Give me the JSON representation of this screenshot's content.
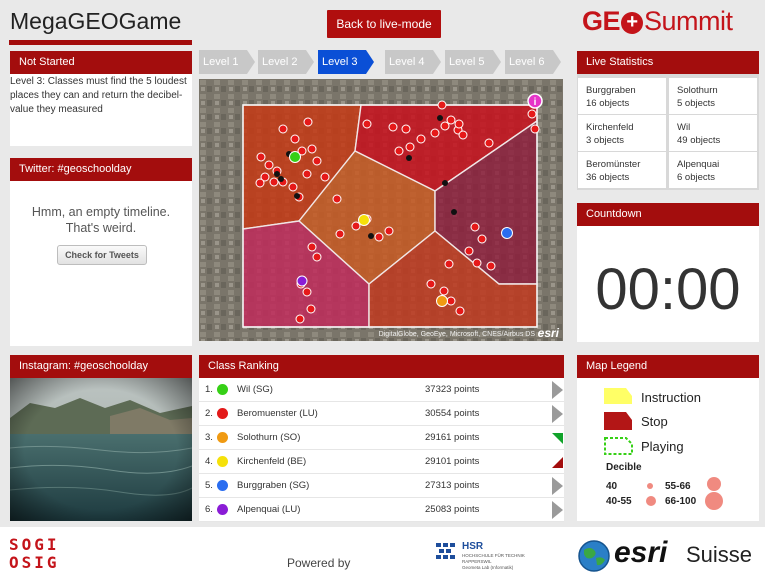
{
  "header": {
    "title": "MegaGEOGame",
    "back_button": "Back to live-mode",
    "logo_left": "GE",
    "logo_right": "Summit"
  },
  "levels": [
    "Level 1",
    "Level 2",
    "Level 3",
    "Level 4",
    "Level 5",
    "Level 6"
  ],
  "active_level": "Level 3",
  "status": {
    "heading": "Not Started",
    "description": "Level 3: Classes must find the 5 loudest places they can and return the decibel-value they measured"
  },
  "twitter": {
    "heading": "Twitter: #geoschoolday",
    "empty_line1": "Hmm, an empty timeline.",
    "empty_line2": "That's weird.",
    "button": "Check for Tweets"
  },
  "instagram": {
    "heading": "Instagram: #geoschoolday"
  },
  "map": {
    "attribution": "DigitalGlobe, GeoEye, Microsoft, CNES/Airbus DS",
    "brand": "esri"
  },
  "live_statistics": {
    "heading": "Live Statistics",
    "cells": [
      {
        "name": "Burggraben",
        "count": "16 objects"
      },
      {
        "name": "Solothurn",
        "count": "5 objects"
      },
      {
        "name": "Kirchenfeld",
        "count": "3 objects"
      },
      {
        "name": "Wil",
        "count": "49 objects"
      },
      {
        "name": "Beromünster",
        "count": "36 objects"
      },
      {
        "name": "Alpenquai",
        "count": "6 objects"
      }
    ]
  },
  "countdown": {
    "heading": "Countdown",
    "value": "00:00"
  },
  "ranking": {
    "heading": "Class Ranking",
    "rows": [
      {
        "rank": "1.",
        "name": "Wil (SG)",
        "points": "37323 points",
        "color": "#36d016",
        "trend": "neutral"
      },
      {
        "rank": "2.",
        "name": "Beromuenster (LU)",
        "points": "30554 points",
        "color": "#e31919",
        "trend": "neutral"
      },
      {
        "rank": "3.",
        "name": "Solothurn (SO)",
        "points": "29161 points",
        "color": "#f09a12",
        "trend": "up"
      },
      {
        "rank": "4.",
        "name": "Kirchenfeld (BE)",
        "points": "29101 points",
        "color": "#f5e10a",
        "trend": "down"
      },
      {
        "rank": "5.",
        "name": "Burggraben (SG)",
        "points": "27313 points",
        "color": "#2a6df0",
        "trend": "neutral"
      },
      {
        "rank": "6.",
        "name": "Alpenquai (LU)",
        "points": "25083 points",
        "color": "#8a1cd6",
        "trend": "neutral"
      }
    ]
  },
  "legend": {
    "heading": "Map Legend",
    "instruction": "Instruction",
    "stop": "Stop",
    "playing": "Playing",
    "decible": "Decible",
    "ranges": [
      "40",
      "55-66",
      "40-55",
      "66-100"
    ]
  },
  "footer": {
    "powered_by": "Powered by",
    "sogi_line1": "SOGI",
    "sogi_line2": "OSIG",
    "hsr_title": "HSR",
    "hsr_sub1": "HOCHSCHULE FÜR TECHNIK",
    "hsr_sub2": "RAPPERSWIL",
    "hsr_sub3": "Geometa Lab (Informatik)",
    "esri_word": "esri",
    "suisse_word": "Suisse"
  },
  "colors": {
    "brand_red": "#a30d0d",
    "active_level": "#0a4fd6",
    "instruction": "#ffff66",
    "stop": "#b31616",
    "playing": "#36d016"
  }
}
